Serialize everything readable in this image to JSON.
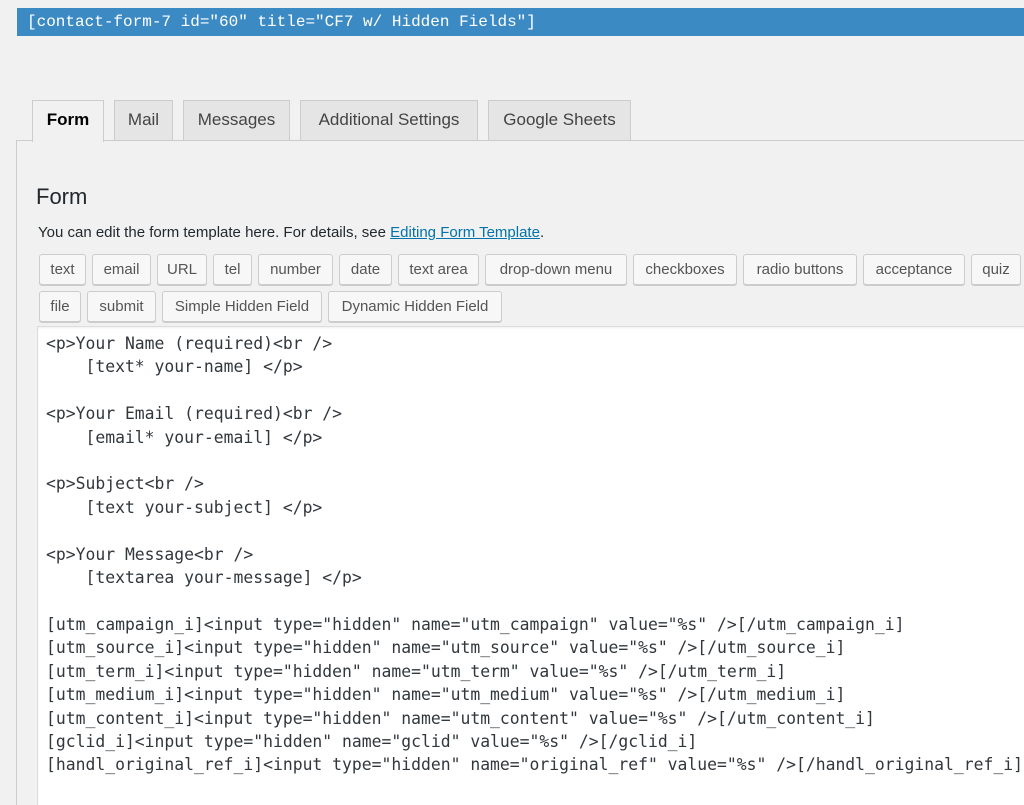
{
  "shortcode": "[contact-form-7 id=\"60\" title=\"CF7 w/ Hidden Fields\"]",
  "tabs": [
    {
      "label": "Form",
      "active": true
    },
    {
      "label": "Mail",
      "active": false
    },
    {
      "label": "Messages",
      "active": false
    },
    {
      "label": "Additional Settings",
      "active": false
    },
    {
      "label": "Google Sheets",
      "active": false
    }
  ],
  "panel": {
    "title": "Form",
    "desc_prefix": "You can edit the form template here. For details, see ",
    "desc_link": "Editing Form Template",
    "desc_suffix": "."
  },
  "tag_buttons": {
    "text": "text",
    "email": "email",
    "url": "URL",
    "tel": "tel",
    "number": "number",
    "date": "date",
    "textarea": "text area",
    "dropdown": "drop-down menu",
    "checkboxes": "checkboxes",
    "radio": "radio buttons",
    "acceptance": "acceptance",
    "quiz": "quiz",
    "file": "file",
    "submit": "submit",
    "simple_hidden": "Simple Hidden Field",
    "dynamic_hidden": "Dynamic Hidden Field"
  },
  "editor": {
    "content": "<p>Your Name (required)<br />\n    [text* your-name] </p>\n\n<p>Your Email (required)<br />\n    [email* your-email] </p>\n\n<p>Subject<br />\n    [text your-subject] </p>\n\n<p>Your Message<br />\n    [textarea your-message] </p>\n\n[utm_campaign_i]<input type=\"hidden\" name=\"utm_campaign\" value=\"%s\" />[/utm_campaign_i]\n[utm_source_i]<input type=\"hidden\" name=\"utm_source\" value=\"%s\" />[/utm_source_i]\n[utm_term_i]<input type=\"hidden\" name=\"utm_term\" value=\"%s\" />[/utm_term_i]\n[utm_medium_i]<input type=\"hidden\" name=\"utm_medium\" value=\"%s\" />[/utm_medium_i]\n[utm_content_i]<input type=\"hidden\" name=\"utm_content\" value=\"%s\" />[/utm_content_i]\n[gclid_i]<input type=\"hidden\" name=\"gclid\" value=\"%s\" />[/gclid_i]\n[handl_original_ref_i]<input type=\"hidden\" name=\"original_ref\" value=\"%s\" />[/handl_original_ref_i]"
  },
  "colors": {
    "shortcode_bg": "#3b8ac4",
    "link": "#0073aa",
    "page_bg": "#f1f1f1"
  }
}
